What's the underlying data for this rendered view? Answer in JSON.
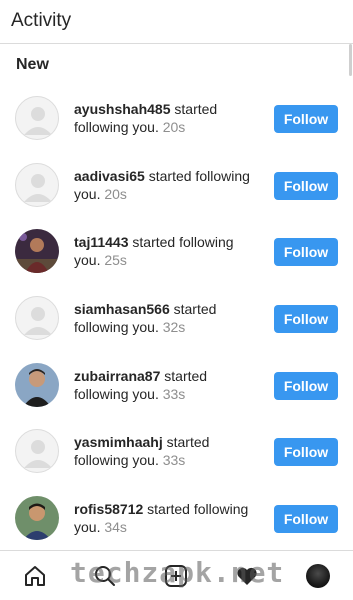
{
  "header": {
    "title": "Activity"
  },
  "section": {
    "title": "New"
  },
  "follow_label": "Follow",
  "activity": [
    {
      "username": "ayushshah485",
      "message": " started following you.",
      "time": " 20s",
      "avatar": "placeholder"
    },
    {
      "username": "aadivasi65",
      "message": " started following you.",
      "time": " 20s",
      "avatar": "placeholder"
    },
    {
      "username": "taj11443",
      "message": " started following you.",
      "time": " 25s",
      "avatar": "photo"
    },
    {
      "username": "siamhasan566",
      "message": " started following you.",
      "time": " 32s",
      "avatar": "placeholder"
    },
    {
      "username": "zubairrana87",
      "message": " started following you.",
      "time": " 33s",
      "avatar": "photo"
    },
    {
      "username": "yasmimhaahj",
      "message": " started following you.",
      "time": " 33s",
      "avatar": "placeholder"
    },
    {
      "username": "rofis58712",
      "message": " started following you.",
      "time": " 34s",
      "avatar": "photo"
    }
  ],
  "tabbar": {
    "icons": [
      "home-icon",
      "search-icon",
      "add-post-icon",
      "heart-icon",
      "profile-avatar"
    ]
  },
  "watermark": "techzapk.net",
  "colors": {
    "follow_button": "#3897f0",
    "divider": "#dbdbdb",
    "timestamp": "#8e8e8e"
  }
}
